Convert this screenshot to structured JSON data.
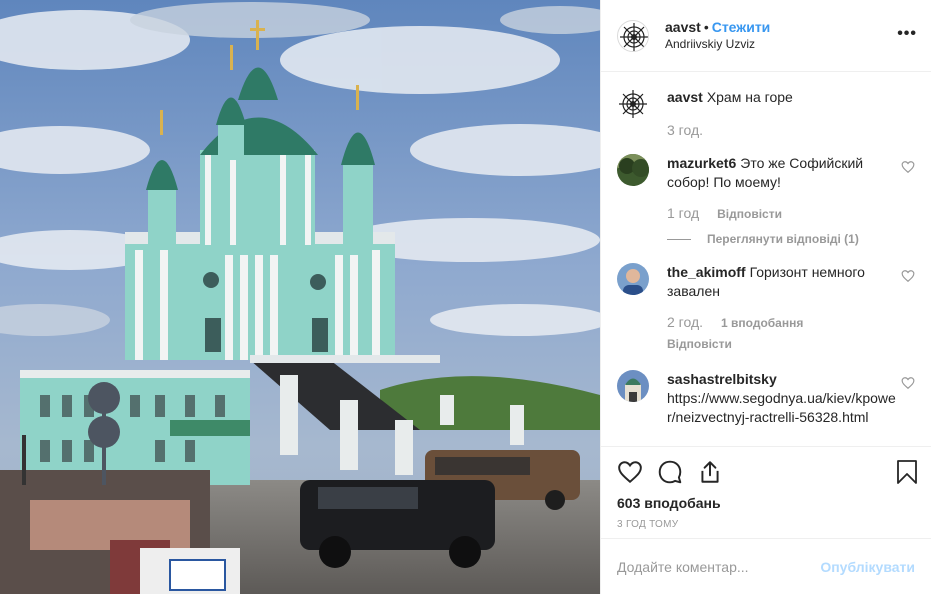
{
  "header": {
    "username": "aavst",
    "separator": "•",
    "follow_label": "Стежити",
    "location": "Andriivskiy Uzviz",
    "more_label": "•••"
  },
  "comments": [
    {
      "user": "aavst",
      "text": "Храм на горе",
      "time": "3 год.",
      "likes": "",
      "reply_label": "",
      "caption": true
    },
    {
      "user": "mazurket6",
      "text": "Это же Софийский собор! По моему!",
      "time": "1 год",
      "likes": "",
      "reply_label": "Відповісти",
      "view_replies": "Переглянути відповіді (1)"
    },
    {
      "user": "the_akimoff",
      "text": "Горизонт немного завален",
      "time": "2 год.",
      "likes": "1 вподобання",
      "reply_label": "Відповісти"
    },
    {
      "user": "sashastrelbitsky",
      "text": "https://www.segodnya.ua/kiev/kpower/neizvectnyj-ractrelli-56328.html",
      "time": "",
      "likes": "",
      "reply_label": ""
    }
  ],
  "actions": {
    "like_icon": "heart-icon",
    "comment_icon": "comment-icon",
    "share_icon": "share-icon",
    "save_icon": "bookmark-icon",
    "likes_count": "603 вподобань",
    "timestamp": "3 год тому"
  },
  "add_comment": {
    "placeholder": "Додайте коментар...",
    "publish_label": "Опублікувати"
  },
  "colors": {
    "accent": "#3897f0",
    "publish_disabled": "#b3dbff",
    "muted": "#999999",
    "text": "#262626",
    "border": "#efefef"
  }
}
